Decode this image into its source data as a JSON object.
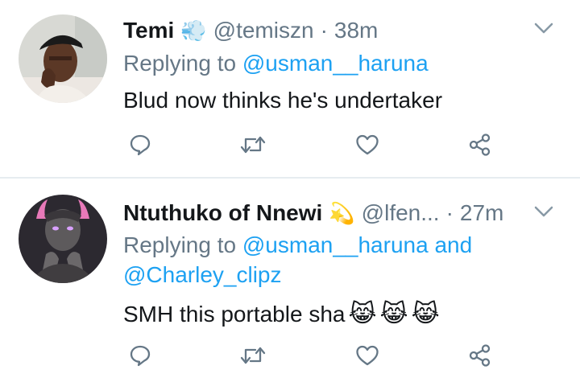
{
  "tweets": [
    {
      "name": "Temi",
      "badge_icon": "dash-cloud-emoji",
      "badge": "💨",
      "handle": "@temiszn",
      "separator": "·",
      "time": "38m",
      "replying_prefix": "Replying to",
      "replying_mentions": [
        "@usman__haruna"
      ],
      "text": "Blud now thinks he's undertaker",
      "emojis": []
    },
    {
      "name": "Ntuthuko of Nnewi",
      "badge_icon": "dizzy-emoji",
      "badge": "💫",
      "handle": "@lfen...",
      "separator": "·",
      "time": "27m",
      "replying_prefix": "Replying to",
      "replying_mentions": [
        "@usman__haruna",
        "@Charley_clipz"
      ],
      "replying_joiner": "and",
      "text": "SMH this portable sha",
      "emojis": [
        "😹",
        "😹",
        "😹"
      ]
    }
  ],
  "colors": {
    "text": "#14171a",
    "secondary": "#657786",
    "accent": "#1da1f2",
    "divider": "#e6ecf0"
  },
  "action_icons": [
    "reply-icon",
    "retweet-icon",
    "like-icon",
    "share-icon"
  ]
}
